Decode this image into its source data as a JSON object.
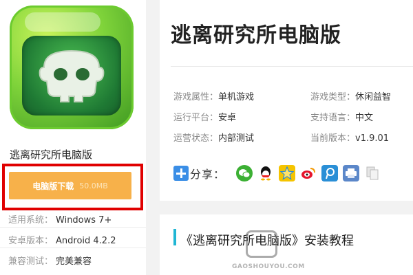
{
  "app": {
    "name": "逃离研究所电脑版",
    "title": "逃离研究所电脑版"
  },
  "download": {
    "label": "电脑版下载",
    "size": "50.0MB"
  },
  "specs": [
    {
      "label": "适用系统：",
      "value": "Windows 7+"
    },
    {
      "label": "安卓版本：",
      "value": "Android 4.2.2"
    },
    {
      "label": "兼容测试：",
      "value": "完美兼容"
    }
  ],
  "attributes": [
    {
      "label": "游戏属性：",
      "value": "单机游戏"
    },
    {
      "label": "游戏类型：",
      "value": "休闲益智"
    },
    {
      "label": "运行平台：",
      "value": "安卓"
    },
    {
      "label": "支持语言：",
      "value": "中文"
    },
    {
      "label": "运营状态：",
      "value": "内部测试"
    },
    {
      "label": "当前版本：",
      "value": "v1.9.01"
    }
  ],
  "share": {
    "label": "分享：",
    "icons": [
      "wechat-icon",
      "qq-icon",
      "qzone-icon",
      "weibo-icon",
      "tencent-weibo-icon",
      "print-icon",
      "copy-icon"
    ]
  },
  "tutorial": {
    "title": "《逃离研究所电脑版》安装教程"
  },
  "watermark": {
    "text": "GAOSHOUYOU.COM"
  },
  "colors": {
    "download_button": "#f7b14a",
    "highlight_frame": "#e00000",
    "accent_bar": "#20b6d4",
    "share_plus": "#3a8ee6"
  }
}
